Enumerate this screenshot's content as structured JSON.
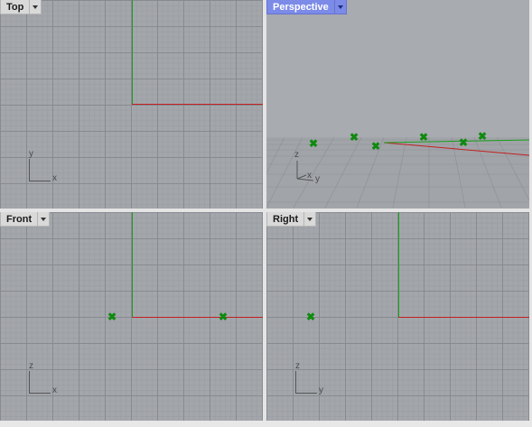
{
  "viewports": {
    "top": {
      "label": "Top",
      "axis_labels": {
        "v": "y",
        "h": "x"
      }
    },
    "perspective": {
      "label": "Perspective",
      "axis_labels": {
        "v": "z",
        "h1": "x",
        "h2": "y"
      }
    },
    "front": {
      "label": "Front",
      "axis_labels": {
        "v": "z",
        "h": "x"
      }
    },
    "right": {
      "label": "Right",
      "axis_labels": {
        "v": "z",
        "h": "y"
      }
    }
  },
  "colors": {
    "x_axis": "#c22020",
    "y_axis": "#1a9e1a",
    "point_marker": "#0f8a0f",
    "active_tab": "#7c8ae8",
    "viewport_bg": "#a3a6ab"
  },
  "active_viewport": "perspective",
  "point_marker_icon": "x-mark-icon"
}
